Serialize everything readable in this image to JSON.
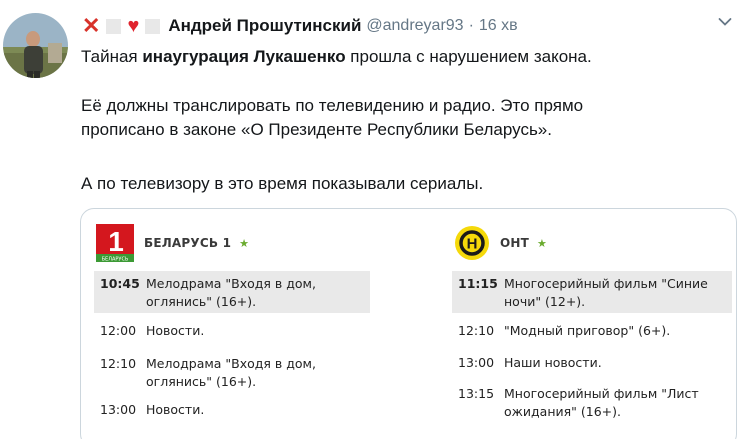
{
  "tweet": {
    "author": "Андрей Прошутинский",
    "handle": "@andreyar93",
    "separator": "·",
    "time": "16 хв",
    "text": {
      "p1_a": "Тайная ",
      "p1_b": "инаугурация Лукашенко",
      "p1_c": " прошла с нарушением закона.",
      "p2_l1": "Её должны транслировать по телевидению и радио. Это прямо",
      "p2_l2": "прописано в законе «О Президенте Республики Беларусь».",
      "p3": "А по телевизору в это время показывали сериалы."
    }
  },
  "colors": {
    "name_emoji_x": "#d8322a",
    "heart": "#e0242e",
    "belarus1_red": "#d4171e",
    "belarus1_green": "#3c9a35",
    "ont_yellow": "#f5d90a",
    "highlight_row": "#e9e9e9"
  },
  "channels": {
    "left": {
      "name": "БЕЛАРУСЬ 1",
      "logo_number": "1",
      "logo_text": "БЕЛАРУСЬ",
      "star": "★",
      "programs": [
        {
          "time": "10:45",
          "l1": "Мелодрама \"Входя в дом,",
          "l2": "оглянись\" (16+).",
          "highlight": true
        },
        {
          "time": "12:00",
          "l1": "Новости.",
          "l2": ""
        },
        {
          "time": "12:10",
          "l1": "Мелодрама \"Входя в дом,",
          "l2": "оглянись\" (16+)."
        },
        {
          "time": "13:00",
          "l1": "Новости.",
          "l2": ""
        }
      ]
    },
    "right": {
      "name": "ОНТ",
      "logo_letter": "Н",
      "star": "★",
      "programs": [
        {
          "time": "11:15",
          "l1": "Многосерийный фильм \"Синие",
          "l2": "ночи\" (12+).",
          "highlight": true
        },
        {
          "time": "12:10",
          "l1": "\"Модный приговор\" (6+).",
          "l2": ""
        },
        {
          "time": "13:00",
          "l1": "Наши новости.",
          "l2": ""
        },
        {
          "time": "13:15",
          "l1": "Многосерийный фильм \"Лист",
          "l2": "ожидания\" (16+)."
        }
      ]
    }
  }
}
